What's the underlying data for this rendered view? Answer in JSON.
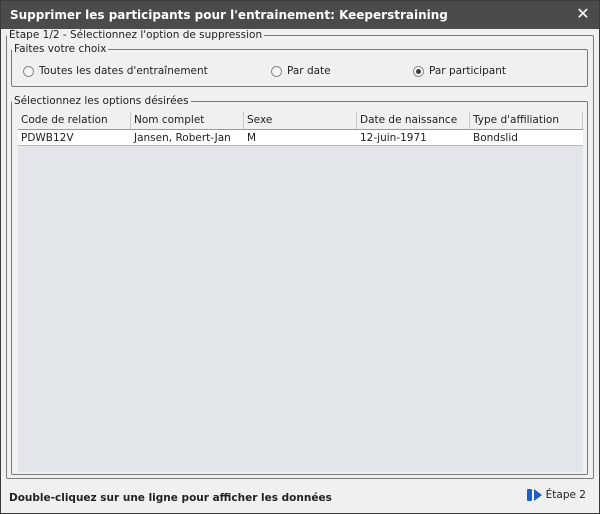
{
  "window": {
    "title": "Supprimer les participants pour l'entrainement: Keeperstraining",
    "close_glyph": "✕"
  },
  "step": {
    "legend": "Étape 1/2 - Sélectionnez l'option de suppression"
  },
  "choice": {
    "legend": "Faites votre choix",
    "options": [
      {
        "label": "Toutes les dates d'entraînement",
        "checked": false
      },
      {
        "label": "Par date",
        "checked": false
      },
      {
        "label": "Par participant",
        "checked": true
      }
    ]
  },
  "options": {
    "legend": "Sélectionnez les options désirées",
    "columns": [
      "Code de relation",
      "Nom complet",
      "Sexe",
      "Date de naissance",
      "Type d'affiliation"
    ],
    "rows": [
      [
        "PDWB12V",
        "Jansen, Robert-Jan",
        "M",
        "12-juin-1971",
        "Bondslid"
      ]
    ]
  },
  "footer": {
    "hint": "Double-cliquez sur une ligne pour afficher les données",
    "next_label": "Étape 2",
    "next_icon": "next-step-icon"
  },
  "colors": {
    "titlebar": "#4b4b4b",
    "next_icon": "#1f5fbf"
  }
}
